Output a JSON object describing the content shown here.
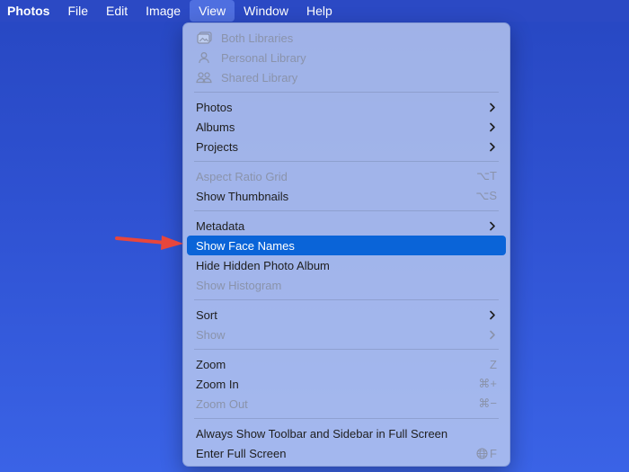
{
  "menubar": {
    "items": [
      {
        "label": "Photos"
      },
      {
        "label": "File"
      },
      {
        "label": "Edit"
      },
      {
        "label": "Image"
      },
      {
        "label": "View"
      },
      {
        "label": "Window"
      },
      {
        "label": "Help"
      }
    ],
    "active": "View"
  },
  "view_menu": {
    "libraries": [
      {
        "label": "Both Libraries",
        "icon": "photo-library-icon",
        "enabled": false
      },
      {
        "label": "Personal Library",
        "icon": "person-icon",
        "enabled": false
      },
      {
        "label": "Shared Library",
        "icon": "people-icon",
        "enabled": false
      }
    ],
    "photos": {
      "label": "Photos",
      "submenu": true
    },
    "albums": {
      "label": "Albums",
      "submenu": true
    },
    "projects": {
      "label": "Projects",
      "submenu": true
    },
    "aspect_ratio_grid": {
      "label": "Aspect Ratio Grid",
      "shortcut": "⌥T",
      "enabled": false
    },
    "show_thumbnails": {
      "label": "Show Thumbnails",
      "shortcut": "⌥S"
    },
    "metadata": {
      "label": "Metadata",
      "submenu": true
    },
    "show_face_names": {
      "label": "Show Face Names",
      "selected": true
    },
    "hide_hidden_album": {
      "label": "Hide Hidden Photo Album"
    },
    "show_histogram": {
      "label": "Show Histogram",
      "enabled": false
    },
    "sort": {
      "label": "Sort",
      "submenu": true
    },
    "show": {
      "label": "Show",
      "submenu": true,
      "enabled": false
    },
    "zoom": {
      "label": "Zoom",
      "shortcut": "Z"
    },
    "zoom_in": {
      "label": "Zoom In",
      "shortcut": "⌘+"
    },
    "zoom_out": {
      "label": "Zoom Out",
      "shortcut": "⌘−",
      "enabled": false
    },
    "always_show_toolbar": {
      "label": "Always Show Toolbar and Sidebar in Full Screen"
    },
    "enter_full_screen": {
      "label": "Enter Full Screen",
      "shortcut": "F",
      "shortcut_icon": "globe-icon"
    }
  },
  "colors": {
    "desktop": "#2f52d2",
    "menubar": "#2b49c4",
    "highlight": "#0a64d8",
    "annotation_arrow": "#e8463c"
  }
}
